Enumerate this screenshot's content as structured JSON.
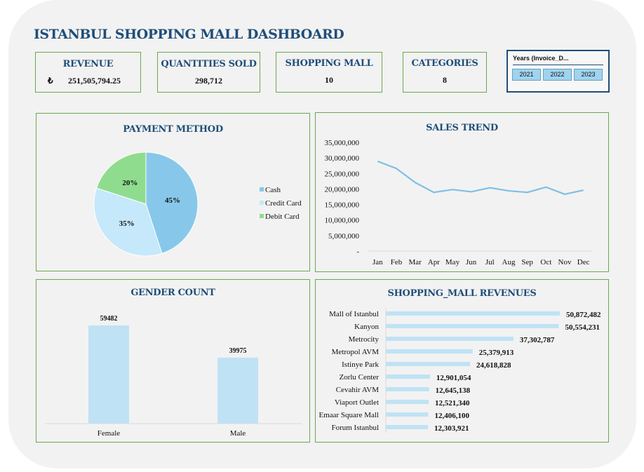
{
  "dashboard": {
    "title": "ISTANBUL SHOPPING MALL DASHBOARD"
  },
  "kpis": {
    "revenue": {
      "label": "REVENUE",
      "currency": "₺",
      "value": "251,505,794.25"
    },
    "quantities": {
      "label": "QUANTITIES SOLD",
      "value": "298,712"
    },
    "malls": {
      "label": "SHOPPING MALL",
      "value": "10"
    },
    "categories": {
      "label": "CATEGORIES",
      "value": "8"
    }
  },
  "slicer": {
    "header": "Years (Invoice_D...",
    "years": [
      "2021",
      "2022",
      "2023"
    ]
  },
  "colors": {
    "accent": "#1f4e79",
    "border": "#6aa84f",
    "cash": "#87c8ea",
    "credit": "#c5e8fa",
    "debit": "#8fdc8f",
    "line": "#7fbfe6",
    "bar": "#c0e2f5"
  },
  "chart_data": [
    {
      "type": "pie",
      "title": "PAYMENT METHOD",
      "categories": [
        "Cash",
        "Credit Card",
        "Debit Card"
      ],
      "values": [
        45,
        35,
        20
      ],
      "labels": [
        "45%",
        "35%",
        "20%"
      ],
      "legend": "right"
    },
    {
      "type": "line",
      "title": "SALES TREND",
      "x": [
        "Jan",
        "Feb",
        "Mar",
        "Apr",
        "May",
        "Jun",
        "Jul",
        "Aug",
        "Sep",
        "Oct",
        "Nov",
        "Dec"
      ],
      "values": [
        28900000,
        26600000,
        22100000,
        18900000,
        19800000,
        19100000,
        20400000,
        19400000,
        18900000,
        20600000,
        18300000,
        19600000
      ],
      "ylim": [
        0,
        35000000
      ],
      "yticks": [
        "35,000,000",
        "30,000,000",
        "25,000,000",
        "20,000,000",
        "15,000,000",
        "10,000,000",
        "5,000,000",
        "-"
      ]
    },
    {
      "type": "bar",
      "title": "GENDER COUNT",
      "categories": [
        "Female",
        "Male"
      ],
      "values": [
        59482,
        39975
      ],
      "labels": [
        "59482",
        "39975"
      ]
    },
    {
      "type": "bar",
      "orientation": "horizontal",
      "title": "SHOPPING_MALL REVENUES",
      "categories": [
        "Mall of Istanbul",
        "Kanyon",
        "Metrocity",
        "Metropol AVM",
        "Istinye Park",
        "Zorlu Center",
        "Cevahir AVM",
        "Viaport Outlet",
        "Emaar Square Mall",
        "Forum Istanbul"
      ],
      "values": [
        50872482,
        50554231,
        37302787,
        25379913,
        24618828,
        12901054,
        12645138,
        12521340,
        12406100,
        12303921
      ],
      "labels": [
        "50,872,482",
        "50,554,231",
        "37,302,787",
        "25,379,913",
        "24,618,828",
        "12,901,054",
        "12,645,138",
        "12,521,340",
        "12,406,100",
        "12,303,921"
      ]
    }
  ]
}
